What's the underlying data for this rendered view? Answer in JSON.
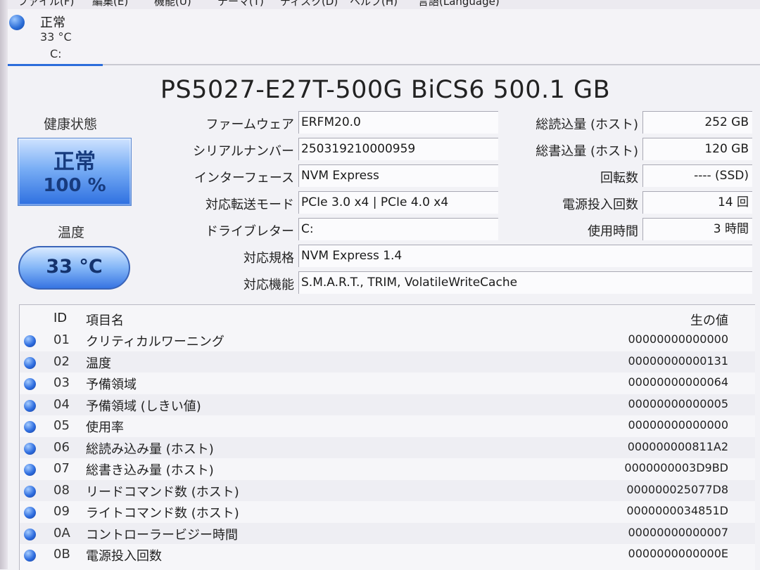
{
  "menu": [
    "ファイル(F)",
    "編集(E)",
    "機能(U)",
    "テーマ(T)",
    "ディスク(D)",
    "ヘルプ(H)",
    "言語(Language)"
  ],
  "disk_tab": {
    "status": "正常",
    "temperature": "33 °C",
    "drive": "C:"
  },
  "model": "PS5027-E27T-500G BiCS6 500.1 GB",
  "health": {
    "label": "健康状態",
    "status": "正常",
    "percent": "100 %"
  },
  "temperature": {
    "label": "温度",
    "value": "33 °C"
  },
  "info_left": [
    {
      "label": "ファームウェア",
      "value": "ERFM20.0"
    },
    {
      "label": "シリアルナンバー",
      "value": "250319210000959"
    },
    {
      "label": "インターフェース",
      "value": "NVM Express"
    },
    {
      "label": "対応転送モード",
      "value": "PCIe 3.0 x4 | PCIe 4.0 x4"
    },
    {
      "label": "ドライブレター",
      "value": "C:"
    },
    {
      "label": "対応規格",
      "value": "NVM Express 1.4"
    },
    {
      "label": "対応機能",
      "value": "S.M.A.R.T., TRIM, VolatileWriteCache"
    }
  ],
  "info_right": [
    {
      "label": "総読込量 (ホスト)",
      "value": "252 GB"
    },
    {
      "label": "総書込量 (ホスト)",
      "value": "120 GB"
    },
    {
      "label": "回転数",
      "value": "---- (SSD)"
    },
    {
      "label": "電源投入回数",
      "value": "14 回"
    },
    {
      "label": "使用時間",
      "value": "3 時間"
    }
  ],
  "smart": {
    "headers": {
      "id": "ID",
      "name": "項目名",
      "raw": "生の値"
    },
    "rows": [
      {
        "id": "01",
        "name": "クリティカルワーニング",
        "raw": "00000000000000"
      },
      {
        "id": "02",
        "name": "温度",
        "raw": "00000000000131"
      },
      {
        "id": "03",
        "name": "予備領域",
        "raw": "00000000000064"
      },
      {
        "id": "04",
        "name": "予備領域 (しきい値)",
        "raw": "00000000000005"
      },
      {
        "id": "05",
        "name": "使用率",
        "raw": "00000000000000"
      },
      {
        "id": "06",
        "name": "総読み込み量 (ホスト)",
        "raw": "000000000811A2"
      },
      {
        "id": "07",
        "name": "総書き込み量 (ホスト)",
        "raw": "0000000003D9BD"
      },
      {
        "id": "08",
        "name": "リードコマンド数 (ホスト)",
        "raw": "000000025077D8"
      },
      {
        "id": "09",
        "name": "ライトコマンド数 (ホスト)",
        "raw": "0000000034851D"
      },
      {
        "id": "0A",
        "name": "コントローラービジー時間",
        "raw": "00000000000007"
      },
      {
        "id": "0B",
        "name": "電源投入回数",
        "raw": "0000000000000E"
      }
    ]
  }
}
